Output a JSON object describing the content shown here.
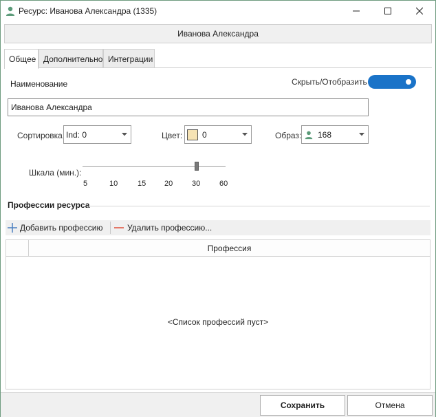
{
  "window": {
    "title": "Ресурс: Иванова Александра  (1335)",
    "icon": "person-icon"
  },
  "header": {
    "caption": "Иванова Александра"
  },
  "tabs": [
    {
      "label": "Общее",
      "active": true
    },
    {
      "label": "Дополнительно",
      "active": false
    },
    {
      "label": "Интеграции",
      "active": false
    }
  ],
  "general": {
    "name_label": "Наименование",
    "name_value": "Иванова Александра",
    "toggle_label": "Скрыть/Отобразить",
    "toggle_on": true,
    "sort_label": "Сортировка:",
    "sort_value": "Ind: 0",
    "color_label": "Цвет:",
    "color_value": "0",
    "color_swatch": "#f6e3b4",
    "image_label": "Образ:",
    "image_value": "168",
    "scale_label": "Шкала (мин.):",
    "scale_ticks": [
      "5",
      "10",
      "15",
      "20",
      "30",
      "60"
    ],
    "scale_selected": "30"
  },
  "professions": {
    "section_title": "Профессии ресурса",
    "add_label": "Добавить профессию",
    "delete_label": "Удалить профессию...",
    "column_header": "Профессия",
    "empty_text": "<Список профессий пуст>"
  },
  "footer": {
    "save_label": "Сохранить",
    "cancel_label": "Отмена"
  },
  "colors": {
    "accent": "#1a73c8",
    "add_icon": "#4a7fc1",
    "delete_icon": "#e0503a",
    "person_icon": "#5a9a78"
  }
}
